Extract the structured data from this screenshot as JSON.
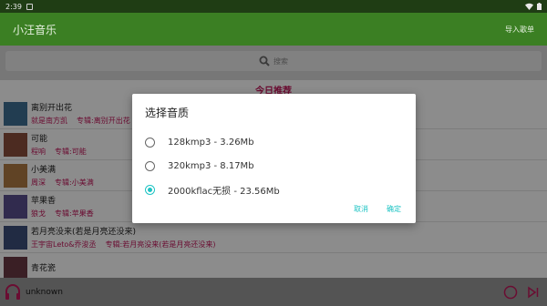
{
  "status": {
    "time": "2:39"
  },
  "appbar": {
    "title": "小汪音乐",
    "import_label": "导入歌单"
  },
  "search": {
    "placeholder": "搜索"
  },
  "section_title": "今日推荐",
  "songs": [
    {
      "title": "离别开出花",
      "artist": "就是南方凯",
      "album": "专辑:离别开出花",
      "cover": "#3f6f94"
    },
    {
      "title": "可能",
      "artist": "程响",
      "album": "专辑:可能",
      "cover": "#8a4f3c"
    },
    {
      "title": "小美满",
      "artist": "周深",
      "album": "专辑:小美满",
      "cover": "#b07a44"
    },
    {
      "title": "苹果香",
      "artist": "狼戈",
      "album": "专辑:苹果香",
      "cover": "#5a4f8f"
    },
    {
      "title": "若月亮没来(若是月亮还没来)",
      "artist": "王宇宙Leto&乔浚丞",
      "album": "专辑:若月亮没来(若是月亮还没来)",
      "cover": "#3c4f7a"
    },
    {
      "title": "青花瓷",
      "artist": "",
      "album": "",
      "cover": "#6a3a44"
    }
  ],
  "player": {
    "track": "unknown"
  },
  "dialog": {
    "title": "选择音质",
    "options": [
      {
        "label": "128kmp3 - 3.26Mb",
        "selected": false
      },
      {
        "label": "320kmp3 - 8.17Mb",
        "selected": false
      },
      {
        "label": "2000kflac无损 - 23.56Mb",
        "selected": true
      }
    ],
    "cancel_label": "取消",
    "confirm_label": "确定",
    "accent": "#1fc4c4"
  }
}
